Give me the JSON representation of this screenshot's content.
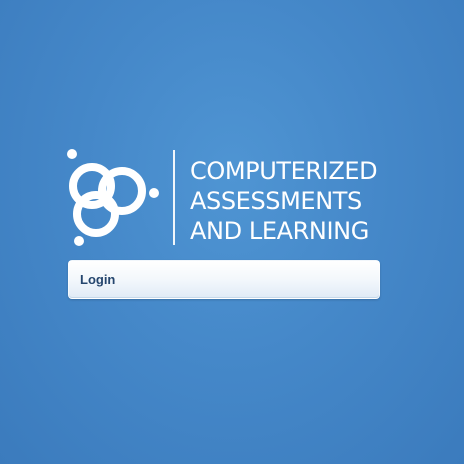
{
  "branding": {
    "logo_icon": "circles-cluster-logo-icon",
    "title_lines": [
      "COMPUTERIZED",
      "ASSESSMENTS",
      "AND LEARNING"
    ]
  },
  "login": {
    "label": "Login"
  },
  "colors": {
    "background": "#4588c9",
    "logo": "#ffffff",
    "button_text": "#25466e",
    "button_background": "#f4f8fc"
  }
}
